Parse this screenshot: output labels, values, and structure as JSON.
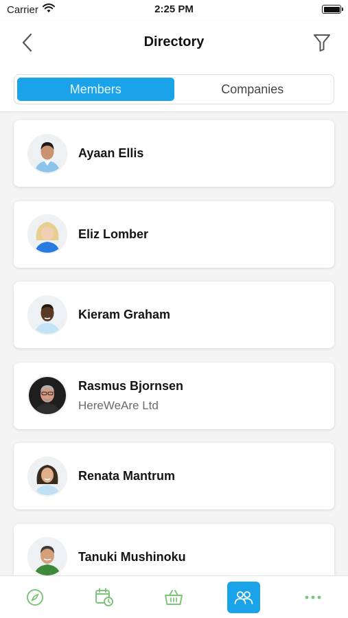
{
  "status_bar": {
    "carrier": "Carrier",
    "time": "2:25 PM"
  },
  "header": {
    "title": "Directory"
  },
  "segments": [
    {
      "label": "Members",
      "active": true
    },
    {
      "label": "Companies",
      "active": false
    }
  ],
  "members": [
    {
      "name": "Ayaan Ellis",
      "company": ""
    },
    {
      "name": "Eliz Lomber",
      "company": ""
    },
    {
      "name": "Kieram Graham",
      "company": ""
    },
    {
      "name": "Rasmus Bjornsen",
      "company": "HereWeAre Ltd"
    },
    {
      "name": "Renata Mantrum",
      "company": ""
    },
    {
      "name": "Tanuki Mushinoku",
      "company": ""
    }
  ],
  "tabbar": {
    "items": [
      {
        "icon": "compass-icon",
        "active": false
      },
      {
        "icon": "calendar-clock-icon",
        "active": false
      },
      {
        "icon": "basket-icon",
        "active": false
      },
      {
        "icon": "people-icon",
        "active": true
      },
      {
        "icon": "more-icon",
        "active": false
      }
    ]
  },
  "colors": {
    "accent": "#1aa3e8",
    "tab_icon": "#7cc576",
    "background": "#f4f4f4"
  }
}
